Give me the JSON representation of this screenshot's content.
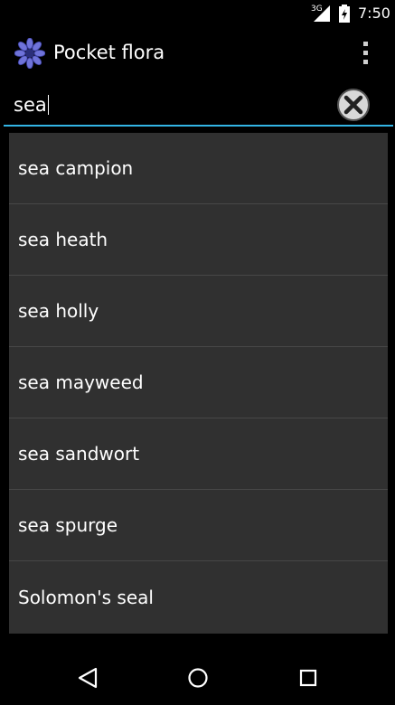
{
  "status_bar": {
    "network_label": "3G",
    "time": "7:50",
    "icons": [
      "signal-icon",
      "battery-charging-icon"
    ]
  },
  "action_bar": {
    "title": "Pocket flora",
    "logo_icon": "cornflower-logo-icon",
    "menu_icon": "overflow-menu-icon"
  },
  "search": {
    "value": "sea",
    "clear_icon": "clear-icon",
    "accent_color": "#33b5e5"
  },
  "suggestions": [
    {
      "label": "sea campion"
    },
    {
      "label": "sea heath"
    },
    {
      "label": "sea holly"
    },
    {
      "label": "sea mayweed"
    },
    {
      "label": "sea sandwort"
    },
    {
      "label": "sea spurge"
    },
    {
      "label": "Solomon's seal"
    }
  ],
  "nav_bar": {
    "icons": [
      "back-icon",
      "home-icon",
      "recents-icon"
    ]
  }
}
